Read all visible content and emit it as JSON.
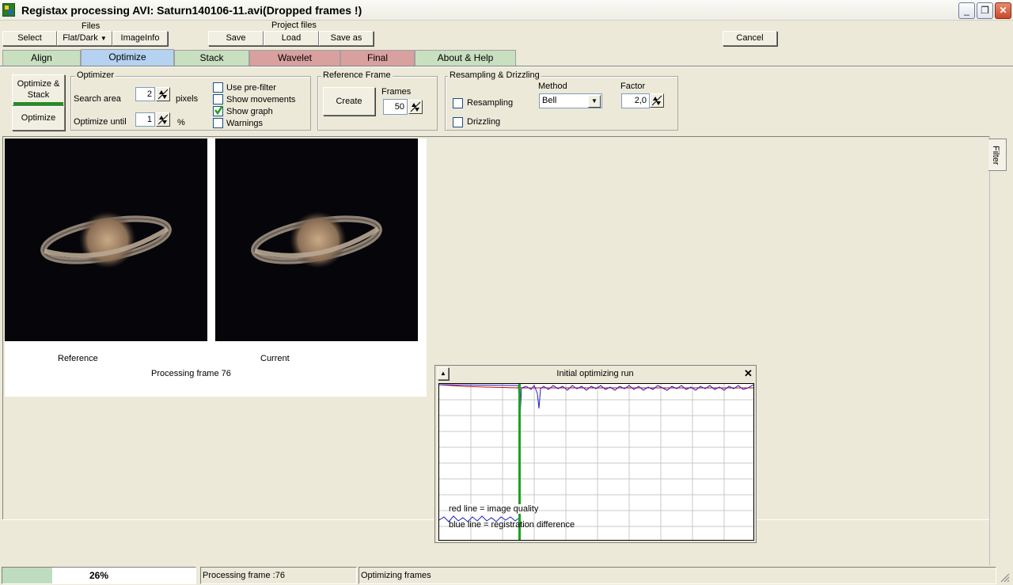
{
  "window": {
    "title": "Registax processing AVI: Saturn140106-11.avi(Dropped frames !)",
    "minimize": "_",
    "restore": "❐",
    "close": "✕"
  },
  "toolbar": {
    "files_label": "Files",
    "select": "Select",
    "flat_dark": "Flat/Dark",
    "image_info": "ImageInfo",
    "project_files_label": "Project files",
    "save": "Save",
    "load": "Load",
    "save_as": "Save as",
    "cancel": "Cancel"
  },
  "tabs": [
    {
      "label": "Align",
      "color": "#c8dfc0"
    },
    {
      "label": "Optimize",
      "color": "#b5d3f0"
    },
    {
      "label": "Stack",
      "color": "#c8dfc0"
    },
    {
      "label": "Wavelet",
      "color": "#d9a0a0"
    },
    {
      "label": "Final",
      "color": "#d9a0a0"
    },
    {
      "label": "About & Help",
      "color": "#c8dfc0"
    }
  ],
  "actions": {
    "optimize_stack": "Optimize & Stack",
    "optimize": "Optimize"
  },
  "optimizer": {
    "title": "Optimizer",
    "search_area_label": "Search area",
    "search_area_value": "2",
    "search_area_unit": "pixels",
    "optimize_until_label": "Optimize until",
    "optimize_until_value": "1",
    "optimize_until_unit": "%",
    "use_prefilter": "Use pre-filter",
    "show_movements": "Show movements",
    "show_graph": "Show graph",
    "warnings": "Warnings"
  },
  "reference_frame": {
    "title": "Reference  Frame",
    "create": "Create",
    "frames_label": "Frames",
    "frames_value": "50"
  },
  "resampling": {
    "title": "Resampling & Drizzling",
    "resampling_label": "Resampling",
    "drizzling_label": "Drizzling",
    "method_label": "Method",
    "method_value": "Bell",
    "factor_label": "Factor",
    "factor_value": "2,0"
  },
  "filter_tab": "Filter",
  "images": {
    "reference_label": "Reference",
    "current_label": "Current",
    "processing_text": "Processing frame 76"
  },
  "graph": {
    "title": "Initial optimizing run",
    "legend_red": "red  line = image quality",
    "legend_blue": "blue line = registration difference"
  },
  "statusbar": {
    "progress_text": "26%",
    "progress_fraction": 0.26,
    "processing": "Processing frame :76",
    "status": "Optimizing frames"
  }
}
